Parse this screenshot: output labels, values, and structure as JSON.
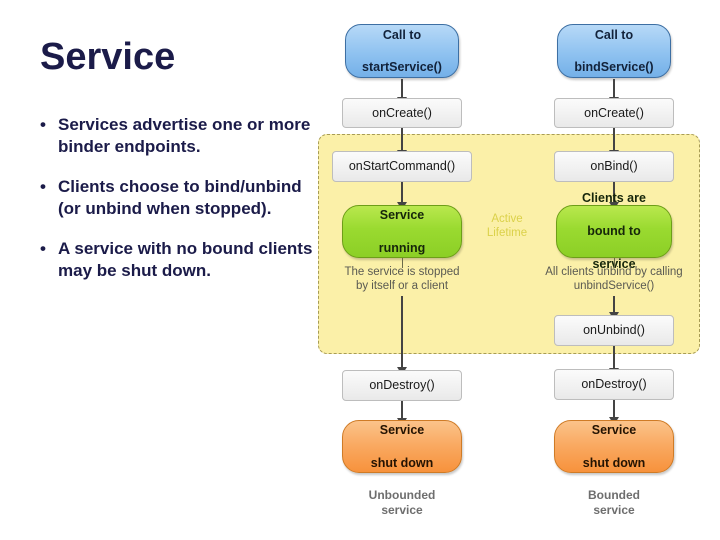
{
  "slide": {
    "title": "Service",
    "bullets": [
      "Services advertise one or more binder endpoints.",
      "Clients choose to bind/unbind (or unbind when stopped).",
      "A service with no bound clients may be shut down."
    ],
    "bullet_marker": "•"
  },
  "diagram": {
    "active_region_label": "Active\nLifetime",
    "active_region_label_line1": "Active",
    "active_region_label_line2": "Lifetime",
    "unbounded": {
      "caption_line1": "Unbounded",
      "caption_line2": "service",
      "start_line1": "Call to",
      "start_line2": "startService()",
      "on_create": "onCreate()",
      "on_start_command": "onStartCommand()",
      "running_line1": "Service",
      "running_line2": "running",
      "stop_note_line1": "The service is stopped",
      "stop_note_line2": "by itself or a client",
      "on_destroy": "onDestroy()",
      "shutdown_line1": "Service",
      "shutdown_line2": "shut down"
    },
    "bounded": {
      "caption_line1": "Bounded",
      "caption_line2": "service",
      "start_line1": "Call to",
      "start_line2": "bindService()",
      "on_create": "onCreate()",
      "on_bind": "onBind()",
      "bound_line1": "Clients are",
      "bound_line2": "bound to",
      "bound_line3": "service",
      "unbind_note_line1": "All clients unbind by calling",
      "unbind_note_line2": "unbindService()",
      "on_unbind": "onUnbind()",
      "on_destroy": "onDestroy()",
      "shutdown_line1": "Service",
      "shutdown_line2": "shut down"
    }
  },
  "colors": {
    "title": "#1b1b49",
    "active_region_fill": "#fbf0a8",
    "active_region_border": "#a89c55",
    "start_node": "#8fc2f0",
    "running_node": "#9ada30",
    "shutdown_node": "#f9a961",
    "step_node": "#f3f3f3"
  }
}
